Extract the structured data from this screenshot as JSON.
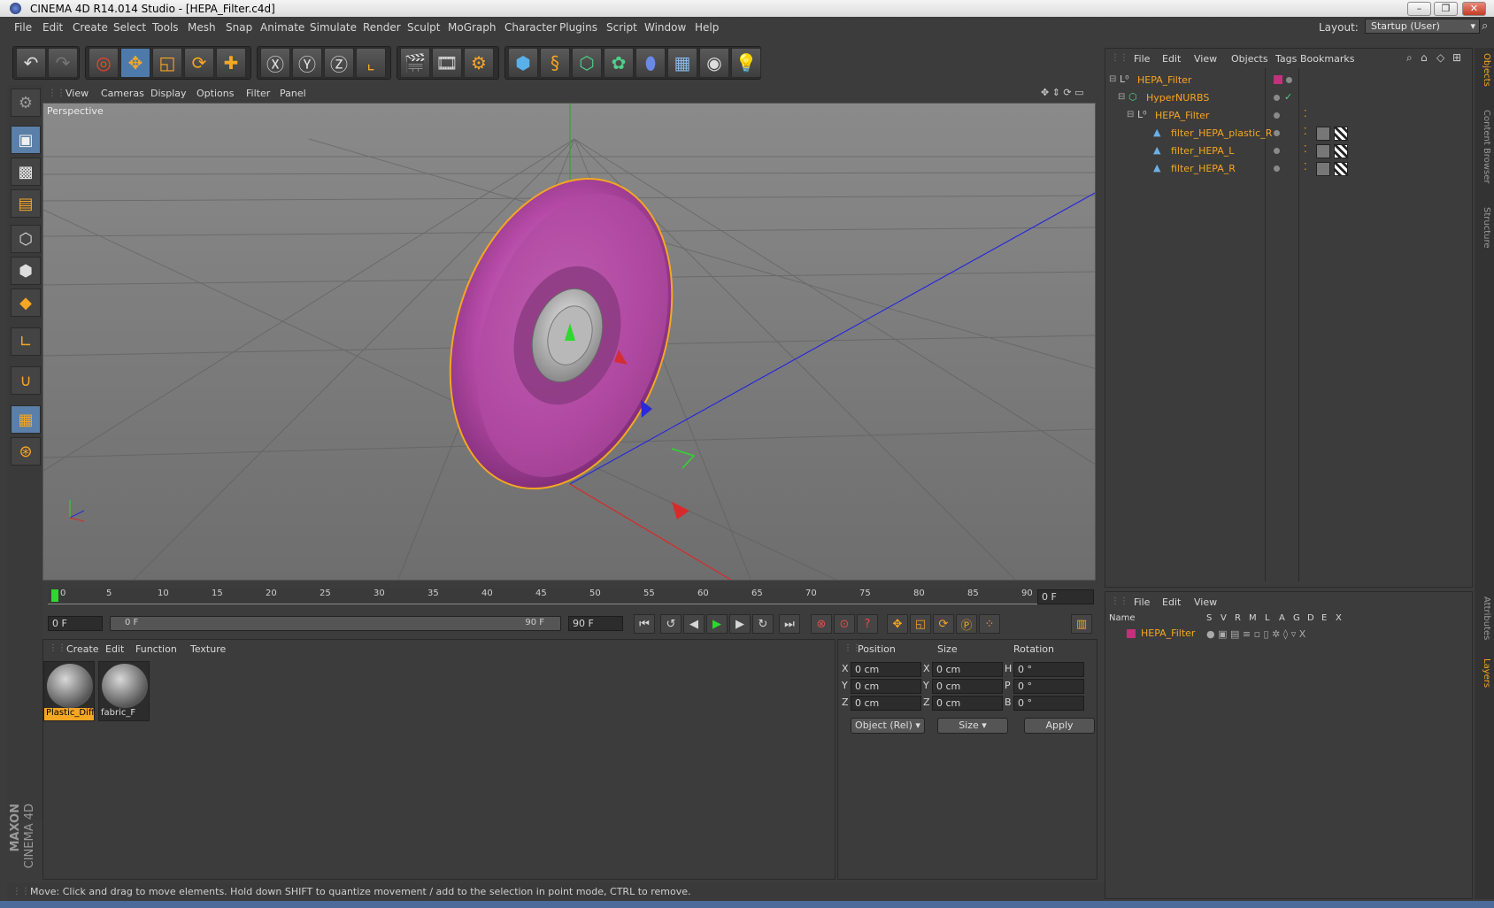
{
  "window": {
    "title": "CINEMA 4D R14.014 Studio - [HEPA_Filter.c4d]"
  },
  "menubar": {
    "items": [
      "File",
      "Edit",
      "Create",
      "Select",
      "Tools",
      "Mesh",
      "Snap",
      "Animate",
      "Simulate",
      "Render",
      "Sculpt",
      "MoGraph",
      "Character",
      "Plugins",
      "Script",
      "Window",
      "Help"
    ],
    "layout_label": "Layout:",
    "layout_value": "Startup (User)"
  },
  "viewport": {
    "menu": [
      "View",
      "Cameras",
      "Display",
      "Options",
      "Filter",
      "Panel"
    ],
    "camera_label": "Perspective",
    "object_color": "#c455b4",
    "selection_color": "#f5a623"
  },
  "timeline": {
    "ticks": [
      "0",
      "5",
      "10",
      "15",
      "20",
      "25",
      "30",
      "35",
      "40",
      "45",
      "50",
      "55",
      "60",
      "65",
      "70",
      "75",
      "80",
      "85",
      "90"
    ],
    "current_frame": "0 F",
    "start_field": "0 F",
    "range_start": "0 F",
    "range_end": "90 F",
    "end_field": "90 F"
  },
  "materials": {
    "menu": [
      "Create",
      "Edit",
      "Function",
      "Texture"
    ],
    "items": [
      {
        "name": "Plastic_Diff",
        "selected": true
      },
      {
        "name": "fabric_F",
        "selected": false
      }
    ]
  },
  "coordinates": {
    "headers": {
      "position": "Position",
      "size": "Size",
      "rotation": "Rotation"
    },
    "rows": [
      {
        "axis": "X",
        "pos": "0 cm",
        "size_axis": "X",
        "size": "0 cm",
        "rot_axis": "H",
        "rot": "0 °"
      },
      {
        "axis": "Y",
        "pos": "0 cm",
        "size_axis": "Y",
        "size": "0 cm",
        "rot_axis": "P",
        "rot": "0 °"
      },
      {
        "axis": "Z",
        "pos": "0 cm",
        "size_axis": "Z",
        "size": "0 cm",
        "rot_axis": "B",
        "rot": "0 °"
      }
    ],
    "mode_select": "Object (Rel)",
    "size_select": "Size",
    "apply_label": "Apply"
  },
  "object_manager": {
    "menu": [
      "File",
      "Edit",
      "View",
      "Objects",
      "Tags",
      "Bookmarks"
    ],
    "objects": [
      {
        "name": "HEPA_Filter",
        "indent": 0
      },
      {
        "name": "HyperNURBS",
        "indent": 1
      },
      {
        "name": "HEPA_Filter",
        "indent": 2
      },
      {
        "name": "filter_HEPA_plastic_R",
        "indent": 3
      },
      {
        "name": "filter_HEPA_L",
        "indent": 3
      },
      {
        "name": "filter_HEPA_R",
        "indent": 3
      }
    ]
  },
  "layer_manager": {
    "menu": [
      "File",
      "Edit",
      "View"
    ],
    "columns": [
      "Name",
      "S",
      "V",
      "R",
      "M",
      "L",
      "A",
      "G",
      "D",
      "E",
      "X"
    ],
    "layers": [
      {
        "name": "HEPA_Filter",
        "color": "#c4307a"
      }
    ]
  },
  "side_tabs": [
    "Objects",
    "Content Browser",
    "Structure",
    "Attributes",
    "Layers"
  ],
  "status": {
    "text": "Move: Click and drag to move elements. Hold down SHIFT to quantize movement / add to the selection in point mode, CTRL to remove."
  },
  "brand": {
    "line1": "MAXON",
    "line2": "CINEMA 4D"
  }
}
